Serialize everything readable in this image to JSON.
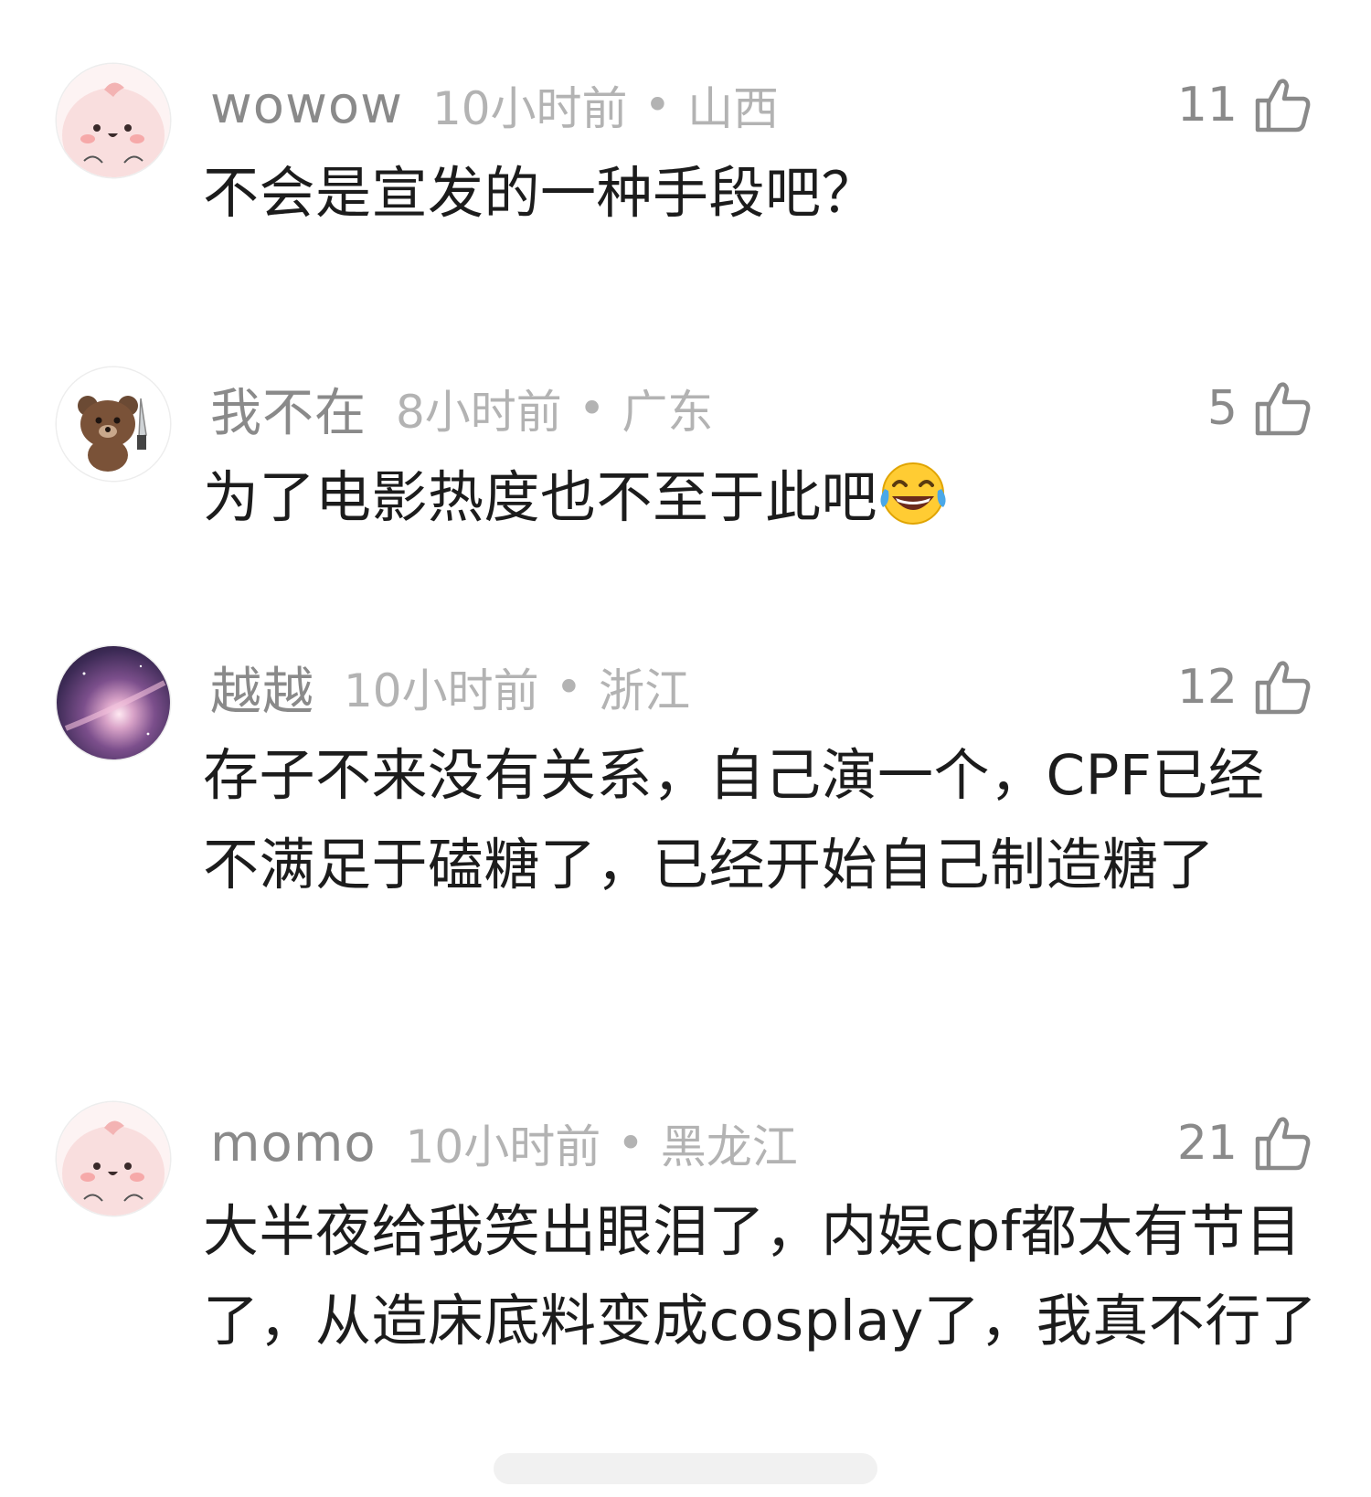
{
  "comments": [
    {
      "username": "wowow",
      "time": "10小时前",
      "location": "山西",
      "likes": "11",
      "text": "不会是宣发的一种手段吧？",
      "avatar": "pink-chick-avatar"
    },
    {
      "username": "我不在",
      "time": "8小时前",
      "location": "广东",
      "likes": "5",
      "text": "为了电影热度也不至于此吧",
      "emoji": "laughing-tears-emoji",
      "avatar": "brown-bear-avatar"
    },
    {
      "username": "越越",
      "time": "10小时前",
      "location": "浙江",
      "likes": "12",
      "text": "存子不来没有关系，自己演一个，CPF已经不满足于磕糖了，已经开始自己制造糖了",
      "avatar": "galaxy-avatar"
    },
    {
      "username": "momo",
      "time": "10小时前",
      "location": "黑龙江",
      "likes": "21",
      "text": "大半夜给我笑出眼泪了，内娱cpf都太有节目了，从造床底料变成cosplay了，我真不行了",
      "avatar": "pink-chick-avatar"
    }
  ],
  "separator": "•",
  "colors": {
    "username": "#8a8a8a",
    "meta": "#b3b3b3",
    "text": "#1c1c1c",
    "icon": "#8a8a8a"
  },
  "icons": {
    "like": "thumbs-up-icon"
  }
}
